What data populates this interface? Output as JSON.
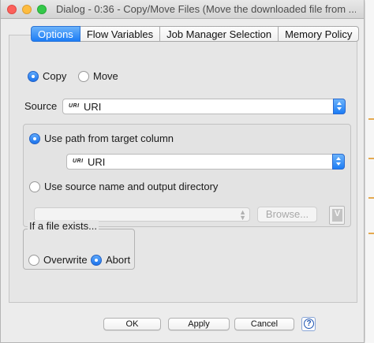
{
  "window": {
    "title": "Dialog - 0:36 - Copy/Move Files (Move the downloaded file from ...)"
  },
  "tabs": [
    {
      "label": "Options",
      "active": true
    },
    {
      "label": "Flow Variables",
      "active": false
    },
    {
      "label": "Job Manager Selection",
      "active": false
    },
    {
      "label": "Memory Policy",
      "active": false
    }
  ],
  "mode": {
    "copy_label": "Copy",
    "move_label": "Move",
    "selected": "Copy"
  },
  "source": {
    "label": "Source",
    "type_tag": "URI",
    "value": "URI"
  },
  "target": {
    "use_path_label": "Use path from target column",
    "column_type_tag": "URI",
    "column_value": "URI",
    "use_source_name_label": "Use source name and output directory",
    "selected": "Use path from target column",
    "directory_value": "",
    "browse_label": "Browse...",
    "variable_icon": "flow-variable-icon"
  },
  "file_exists": {
    "legend": "If a file exists...",
    "overwrite_label": "Overwrite",
    "abort_label": "Abort",
    "selected": "Abort"
  },
  "footer": {
    "ok_label": "OK",
    "apply_label": "Apply",
    "cancel_label": "Cancel",
    "help_icon": "help-icon",
    "help_glyph": "?"
  },
  "colors": {
    "accent": "#1c7cf5",
    "window_bg": "#ececec"
  }
}
